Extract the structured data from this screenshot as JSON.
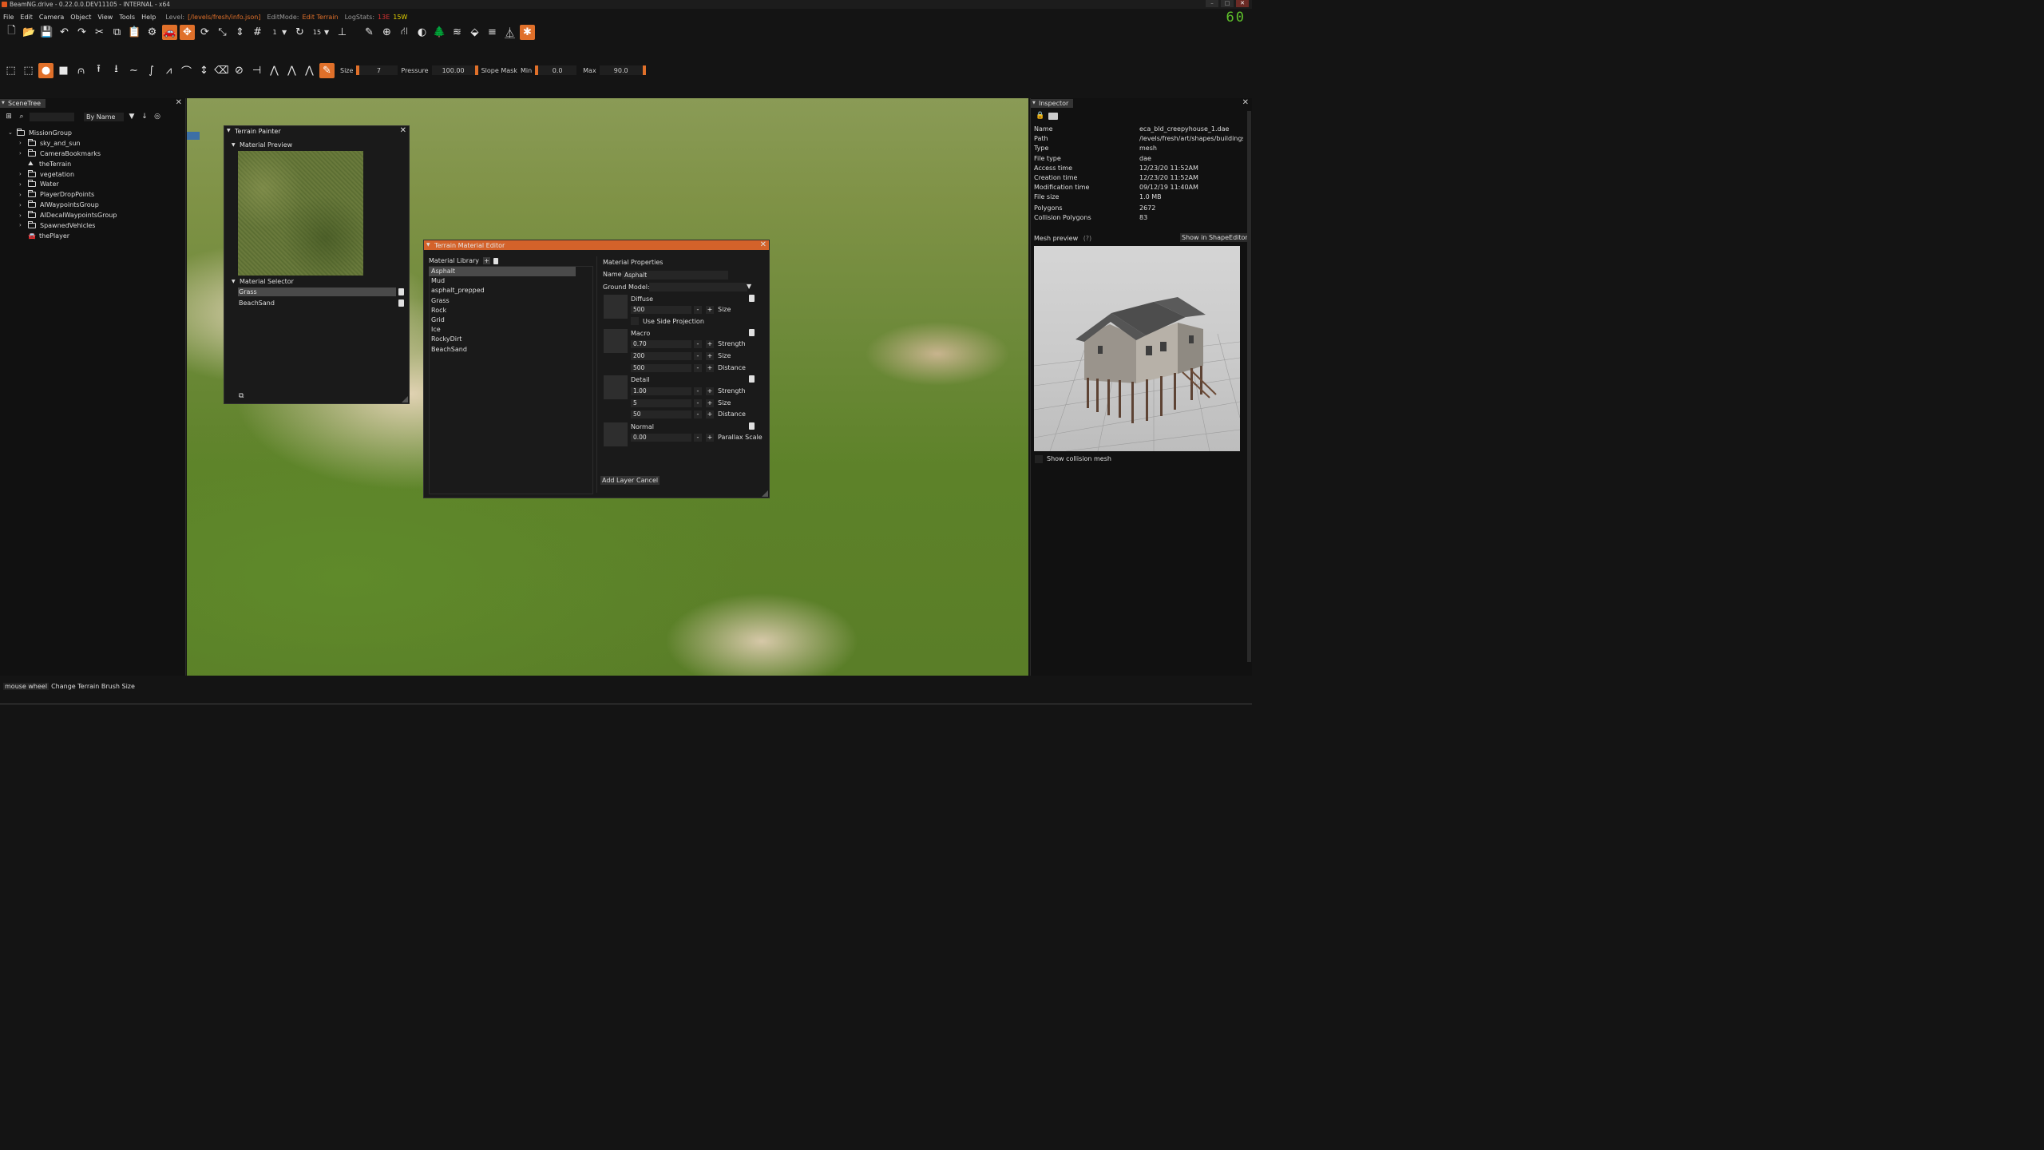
{
  "window": {
    "title": "BeamNG.drive - 0.22.0.0.DEV11105 - INTERNAL - x64",
    "fps": "60"
  },
  "menu": {
    "items": [
      "File",
      "Edit",
      "Camera",
      "Object",
      "View",
      "Tools",
      "Help"
    ],
    "level_label": "Level:",
    "level_value": "[/levels/fresh/info.json]",
    "editmode_label": "EditMode:",
    "editmode_value": "Edit Terrain",
    "logstats_label": "LogStats:",
    "log_errors": "13E",
    "log_warnings": "15W"
  },
  "toolbar1": {
    "snap_value": "1",
    "rotate_value": "15"
  },
  "toolbar2": {
    "size_label": "Size",
    "size_value": "7",
    "pressure_label": "Pressure",
    "pressure_value": "100.00",
    "slope_label": "Slope Mask",
    "min_label": "Min",
    "min_value": "0.0",
    "max_label": "Max",
    "max_value": "90.0"
  },
  "scenetree": {
    "title": "SceneTree",
    "sort": "By Name",
    "items": [
      {
        "label": "MissionGroup",
        "depth": 0,
        "caret": "v",
        "kind": "folder"
      },
      {
        "label": "sky_and_sun",
        "depth": 1,
        "caret": ">",
        "kind": "folder"
      },
      {
        "label": "CameraBookmarks",
        "depth": 1,
        "caret": ">",
        "kind": "folder"
      },
      {
        "label": "theTerrain",
        "depth": 1,
        "caret": "",
        "kind": "terrain"
      },
      {
        "label": "vegetation",
        "depth": 1,
        "caret": ">",
        "kind": "folder"
      },
      {
        "label": "Water",
        "depth": 1,
        "caret": ">",
        "kind": "folder"
      },
      {
        "label": "PlayerDropPoints",
        "depth": 1,
        "caret": ">",
        "kind": "folder"
      },
      {
        "label": "AIWaypointsGroup",
        "depth": 1,
        "caret": ">",
        "kind": "folder"
      },
      {
        "label": "AIDecalWaypointsGroup",
        "depth": 1,
        "caret": ">",
        "kind": "folder"
      },
      {
        "label": "SpawnedVehicles",
        "depth": 1,
        "caret": ">",
        "kind": "folder"
      },
      {
        "label": "thePlayer",
        "depth": 1,
        "caret": "",
        "kind": "car"
      }
    ]
  },
  "terrain_painter": {
    "title": "Terrain Painter",
    "preview_header": "Material Preview",
    "selector_header": "Material Selector",
    "materials": [
      "Grass",
      "BeachSand"
    ]
  },
  "material_editor": {
    "title": "Terrain Material Editor",
    "library_label": "Material Library",
    "library": [
      "Asphalt",
      "Mud",
      "asphalt_prepped",
      "Grass",
      "Rock",
      "Grid",
      "Ice",
      "RockyDirt",
      "BeachSand"
    ],
    "properties_label": "Material Properties",
    "name_label": "Name",
    "name_value": "Asphalt",
    "ground_model_label": "Ground Model:",
    "diffuse": {
      "label": "Diffuse",
      "size": "500",
      "size_label": "Size",
      "side_projection": "Use Side Projection"
    },
    "macro": {
      "label": "Macro",
      "strength": "0.70",
      "size": "200",
      "distance": "500",
      "strength_label": "Strength",
      "size_label": "Size",
      "distance_label": "Distance"
    },
    "detail": {
      "label": "Detail",
      "strength": "1.00",
      "size": "5",
      "distance": "50",
      "strength_label": "Strength",
      "size_label": "Size",
      "distance_label": "Distance"
    },
    "normal": {
      "label": "Normal",
      "parallax": "0.00",
      "parallax_label": "Parallax Scale"
    },
    "add_layer": "Add Layer",
    "cancel": "Cancel",
    "minus": "-",
    "plus": "+"
  },
  "inspector": {
    "title": "Inspector",
    "rows": [
      {
        "k": "Name",
        "v": "eca_bld_creepyhouse_1.dae"
      },
      {
        "k": "Path",
        "v": "/levels/fresh/art/shapes/buildings/ec"
      },
      {
        "k": "Type",
        "v": "mesh"
      },
      {
        "k": "File type",
        "v": "dae"
      },
      {
        "k": "Access time",
        "v": "12/23/20 11:52AM"
      },
      {
        "k": "Creation time",
        "v": "12/23/20 11:52AM"
      },
      {
        "k": "Modification time",
        "v": "09/12/19 11:40AM"
      },
      {
        "k": "File size",
        "v": "1.0 MB"
      },
      {
        "k": "Polygons",
        "v": "2672"
      },
      {
        "k": "Collision Polygons",
        "v": "83"
      }
    ],
    "mesh_preview_label": "Mesh preview",
    "help": "(?)",
    "show_in_shape_editor": "Show in ShapeEditor",
    "show_collision": "Show collision mesh"
  },
  "status": {
    "key": "mouse wheel",
    "action": "Change Terrain Brush Size"
  },
  "colors": {
    "accent": "#e0702a",
    "window_title_active": "#d4622a",
    "fps": "#5ec02b",
    "log_error": "#dd3333",
    "log_warning": "#e6d400"
  }
}
